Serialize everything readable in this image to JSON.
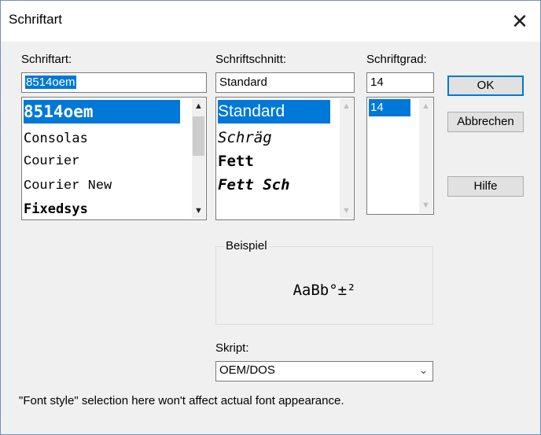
{
  "window": {
    "title": "Schriftart",
    "close_symbol": "✕"
  },
  "font": {
    "label": "Schriftart:",
    "value": "8514oem",
    "items": [
      "8514oem",
      "Consolas",
      "Courier",
      "Courier New",
      "Fixedsys"
    ],
    "selected": "8514oem"
  },
  "style": {
    "label": "Schriftschnitt:",
    "value": "Standard",
    "items": [
      "Standard",
      "Schräg",
      "Fett",
      "Fett Sch"
    ],
    "selected": "Standard"
  },
  "size": {
    "label": "Schriftgrad:",
    "value": "14",
    "items": [
      "14"
    ],
    "selected": "14"
  },
  "buttons": {
    "ok": "OK",
    "cancel": "Abbrechen",
    "help": "Hilfe"
  },
  "sample": {
    "label": "Beispiel",
    "text": "AaBb°±²"
  },
  "script": {
    "label": "Skript:",
    "value": "OEM/DOS"
  },
  "note": "\"Font style\" selection here won't affect actual font appearance.",
  "colors": {
    "selection": "#0078d7",
    "default_button_border": "#0078d7"
  }
}
